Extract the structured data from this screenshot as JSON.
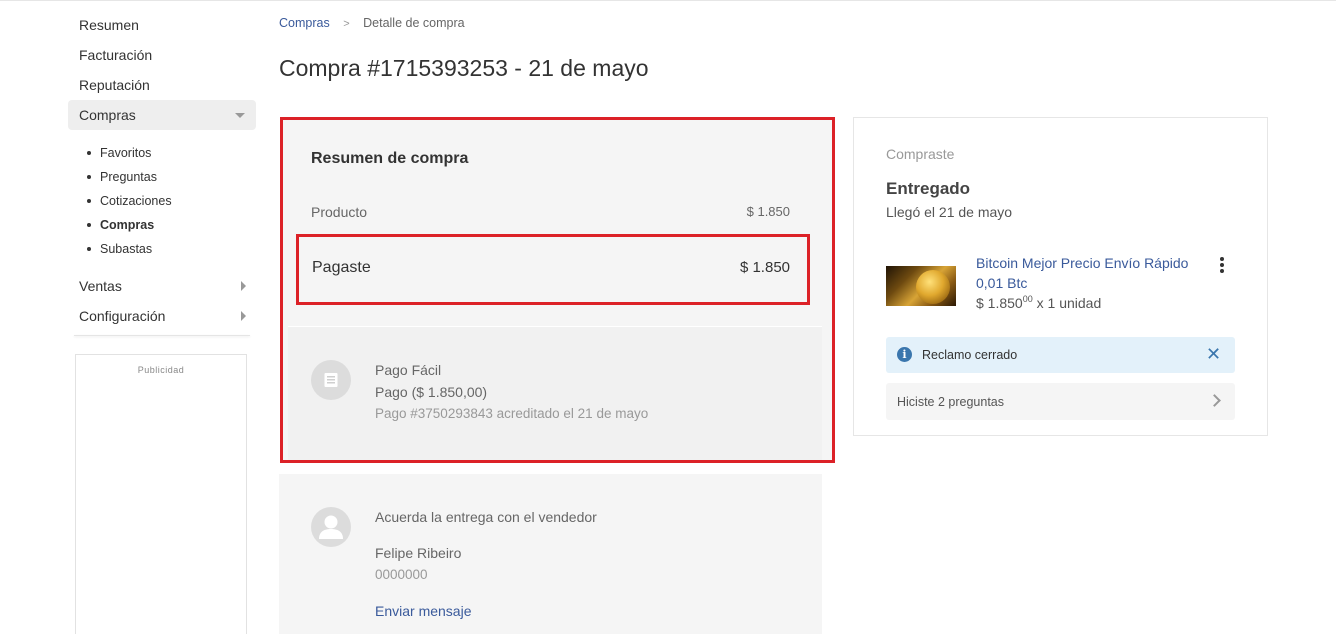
{
  "sidebar": {
    "items": [
      {
        "label": "Resumen"
      },
      {
        "label": "Facturación"
      },
      {
        "label": "Reputación"
      },
      {
        "label": "Compras"
      }
    ],
    "sub_items": [
      {
        "label": "Favoritos"
      },
      {
        "label": "Preguntas"
      },
      {
        "label": "Cotizaciones"
      },
      {
        "label": "Compras"
      },
      {
        "label": "Subastas"
      }
    ],
    "bottom_items": [
      {
        "label": "Ventas"
      },
      {
        "label": "Configuración"
      }
    ],
    "ad_label": "Publicidad"
  },
  "breadcrumb": {
    "parent": "Compras",
    "separator": ">",
    "current": "Detalle de compra"
  },
  "page_title": "Compra #1715393253 - 21 de mayo",
  "summary": {
    "title": "Resumen de compra",
    "product_label": "Producto",
    "product_amount": "$ 1.850",
    "paid_label": "Pagaste",
    "paid_amount": "$ 1.850",
    "payment": {
      "icon": "receipt-icon",
      "method": "Pago Fácil",
      "amount_text": "Pago ($ 1.850,00)",
      "detail": "Pago #3750293843 acreditado el 21 de mayo"
    }
  },
  "delivery": {
    "icon": "user-icon",
    "title": "Acuerda la entrega con el vendedor",
    "seller_name": "Felipe Ribeiro",
    "seller_phone": "0000000",
    "send_message": "Enviar mensaje"
  },
  "order": {
    "label": "Compraste",
    "status": "Entregado",
    "arrived": "Llegó el 21 de mayo",
    "product_title": "Bitcoin Mejor Precio Envío Rápido 0,01 Btc",
    "price_main": "$ 1.850",
    "price_cents": "00",
    "quantity": "x 1 unidad",
    "claim_text": "Reclamo cerrado",
    "questions_text": "Hiciste 2 preguntas"
  },
  "colors": {
    "link": "#3a5a9b",
    "highlight": "#dc2127",
    "info": "#3a76ad",
    "info_bg": "#e3f1fa"
  }
}
